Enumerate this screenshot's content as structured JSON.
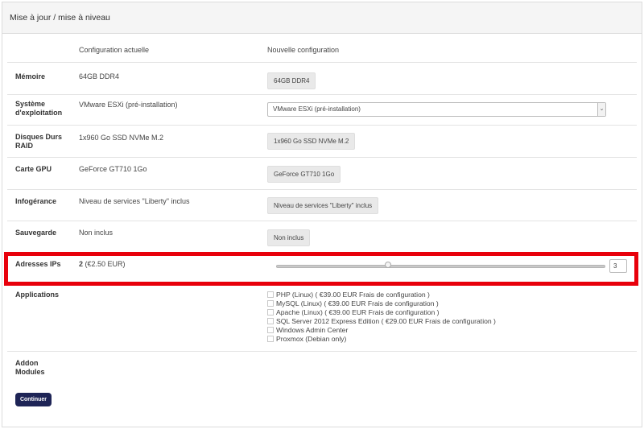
{
  "panel": {
    "title": "Mise à jour / mise à niveau"
  },
  "columns": {
    "current": "Configuration actuelle",
    "new": "Nouvelle configuration"
  },
  "rows": [
    {
      "label": "Mémoire",
      "current": "64GB DDR4",
      "new": "64GB DDR4"
    },
    {
      "label": "Système d'exploitation",
      "current": "VMware ESXi (pré-installation)",
      "new": "VMware ESXi (pré-installation)"
    },
    {
      "label": "Disques Durs RAID",
      "current": "1x960 Go SSD NVMe M.2",
      "new": "1x960 Go SSD NVMe M.2"
    },
    {
      "label": "Carte GPU",
      "current": "GeForce GT710 1Go",
      "new": "GeForce GT710 1Go"
    },
    {
      "label": "Infogérance",
      "current": "Niveau de services \"Liberty\" inclus",
      "new": "Niveau de services \"Liberty\" inclus"
    },
    {
      "label": "Sauvegarde",
      "current": "Non inclus",
      "new": "Non inclus"
    }
  ],
  "ip_row": {
    "label": "Adresses IPs",
    "current_count": "2",
    "current_price": "(€2.50 EUR)",
    "input_value": "3",
    "slider_fraction": 0.34
  },
  "applications": {
    "label": "Applications",
    "items": [
      "PHP (Linux) ( €39.00 EUR Frais de configuration )",
      "MySQL (Linux) ( €39.00 EUR Frais de configuration )",
      "Apache (Linux) ( €39.00 EUR Frais de configuration )",
      "SQL Server 2012 Express Edition ( €29.00 EUR Frais de configuration )",
      "Windows Admin Center",
      "Proxmox (Debian only)"
    ]
  },
  "addons": {
    "label": "Addon Modules"
  },
  "continue_button": "Continuer",
  "colors": {
    "button": "#1e2456",
    "highlight": "#e8000b"
  }
}
